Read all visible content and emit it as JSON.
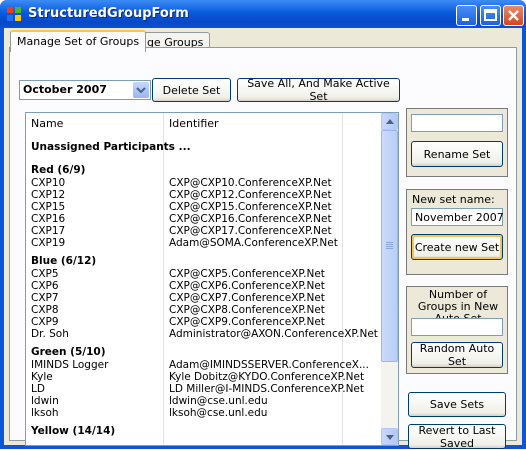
{
  "window": {
    "title": "StructuredGroupForm"
  },
  "tabs": [
    {
      "label": "Manage Set of Groups",
      "active": true
    },
    {
      "label": "Manage Groups",
      "active": false
    }
  ],
  "toolbar": {
    "set_select_value": "October 2007",
    "delete_label": "Delete Set",
    "save_all_label": "Save All, And Make Active Set"
  },
  "list": {
    "columns": [
      "Name",
      "Identifier"
    ],
    "rows": [
      {
        "kind": "group",
        "name": "Unassigned Participants ...",
        "id": ""
      },
      {
        "kind": "group",
        "name": "Red  (6/9)",
        "id": ""
      },
      {
        "kind": "item",
        "name": "CXP10",
        "id": "CXP@CXP10.ConferenceXP.Net"
      },
      {
        "kind": "item",
        "name": "CXP12",
        "id": "CXP@CXP12.ConferenceXP.Net"
      },
      {
        "kind": "item",
        "name": "CXP15",
        "id": "CXP@CXP15.ConferenceXP.Net"
      },
      {
        "kind": "item",
        "name": "CXP16",
        "id": "CXP@CXP16.ConferenceXP.Net"
      },
      {
        "kind": "item",
        "name": "CXP17",
        "id": "CXP@CXP17.ConferenceXP.Net"
      },
      {
        "kind": "item",
        "name": "CXP19",
        "id": "Adam@SOMA.ConferenceXP.Net"
      },
      {
        "kind": "group",
        "name": "Blue  (6/12)",
        "id": ""
      },
      {
        "kind": "item",
        "name": "CXP5",
        "id": "CXP@CXP5.ConferenceXP.Net"
      },
      {
        "kind": "item",
        "name": "CXP6",
        "id": "CXP@CXP6.ConferenceXP.Net"
      },
      {
        "kind": "item",
        "name": "CXP7",
        "id": "CXP@CXP7.ConferenceXP.Net"
      },
      {
        "kind": "item",
        "name": "CXP8",
        "id": "CXP@CXP8.ConferenceXP.Net"
      },
      {
        "kind": "item",
        "name": "CXP9",
        "id": "CXP@CXP9.ConferenceXP.Net"
      },
      {
        "kind": "item",
        "name": "Dr. Soh",
        "id": "Administrator@AXON.ConferenceXP.Net"
      },
      {
        "kind": "group",
        "name": "Green  (5/10)",
        "id": ""
      },
      {
        "kind": "item",
        "name": "IMINDS Logger",
        "id": "Adam@IMINDSSERVER.ConferenceX..."
      },
      {
        "kind": "item",
        "name": "Kyle",
        "id": "Kyle Dobitz@KYDO.ConferenceXP.Net"
      },
      {
        "kind": "item",
        "name": "LD",
        "id": "LD Miller@I-MINDS.ConferenceXP.Net"
      },
      {
        "kind": "item",
        "name": "ldwin",
        "id": "ldwin@cse.unl.edu"
      },
      {
        "kind": "item",
        "name": "lksoh",
        "id": "lksoh@cse.unl.edu"
      },
      {
        "kind": "group",
        "name": "Yellow  (14/14)",
        "id": ""
      }
    ]
  },
  "rename_panel": {
    "input_value": "",
    "button_label": "Rename Set"
  },
  "new_set_panel": {
    "label": "New set name:",
    "input_value": "November 2007",
    "button_label": "Create new Set"
  },
  "auto_set_panel": {
    "label": "Number of Groups in New Auto Set",
    "input_value": "",
    "button_label": "Random Auto Set"
  },
  "footer": {
    "save_label": "Save Sets",
    "revert_label": "Revert to Last Saved"
  }
}
